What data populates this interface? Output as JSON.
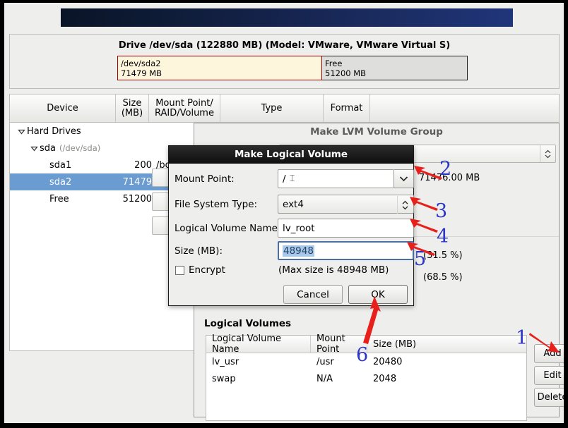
{
  "window": {
    "title": ""
  },
  "drive_summary": {
    "title": "Drive /dev/sda (122880 MB) (Model: VMware, VMware Virtual S)",
    "segments": [
      {
        "name": "/dev/sda2",
        "size": "71479 MB",
        "kind": "used"
      },
      {
        "name": "Free",
        "size": "51200 MB",
        "kind": "free"
      }
    ]
  },
  "columns": {
    "device": "Device",
    "size_l1": "Size",
    "size_l2": "(MB)",
    "mount_l1": "Mount Point/",
    "mount_l2": "RAID/Volume",
    "type": "Type",
    "format": "Format"
  },
  "tree": {
    "rows": [
      {
        "label": "Hard Drives",
        "device": "",
        "size": "",
        "mount": "",
        "indent": 0,
        "twisty": "down",
        "selected": false
      },
      {
        "label": "sda",
        "device": "(/dev/sda)",
        "size": "",
        "mount": "",
        "indent": 1,
        "twisty": "down",
        "selected": false
      },
      {
        "label": "sda1",
        "device": "",
        "size": "200",
        "mount": "/bo",
        "indent": 2,
        "twisty": "none",
        "selected": false
      },
      {
        "label": "sda2",
        "device": "",
        "size": "71479",
        "mount": "",
        "indent": 2,
        "twisty": "none",
        "selected": true
      },
      {
        "label": "Free",
        "device": "",
        "size": "51200",
        "mount": "",
        "indent": 2,
        "twisty": "none",
        "selected": false
      }
    ]
  },
  "lvm_dialog": {
    "title": "Make LVM Volume Group",
    "total_space_value": "71476.00 MB",
    "used_percent": "(31.5 %)",
    "free_percent": "(68.5 %)",
    "logical_volumes_heading": "Logical Volumes",
    "table": {
      "headers": [
        "Logical Volume Name",
        "Mount Point",
        "Size (MB)"
      ],
      "rows": [
        {
          "name": "lv_usr",
          "mount": "/usr",
          "size": "20480"
        },
        {
          "name": "swap",
          "mount": "N/A",
          "size": "2048"
        }
      ]
    },
    "buttons": {
      "add": "Add",
      "edit": "Edit",
      "delete": "Delete"
    }
  },
  "make_logical_volume": {
    "title": "Make Logical Volume",
    "labels": {
      "mount_point": "Mount Point:",
      "file_system_type": "File System Type:",
      "logical_volume_name": "Logical Volume Name:",
      "size_mb": "Size (MB):",
      "encrypt": "Encrypt"
    },
    "values": {
      "mount_point": "/",
      "file_system_type": "ext4",
      "logical_volume_name": "lv_root",
      "size_mb": "48948"
    },
    "max_size_note": "(Max size is 48948 MB)",
    "encrypt_checked": false,
    "buttons": {
      "cancel": "Cancel",
      "ok": "OK"
    }
  },
  "annotations": {
    "color": "#2b35c8",
    "arrow_color": "#e8201c",
    "numbers": [
      "1",
      "2",
      "3",
      "4",
      "5",
      "6"
    ]
  }
}
